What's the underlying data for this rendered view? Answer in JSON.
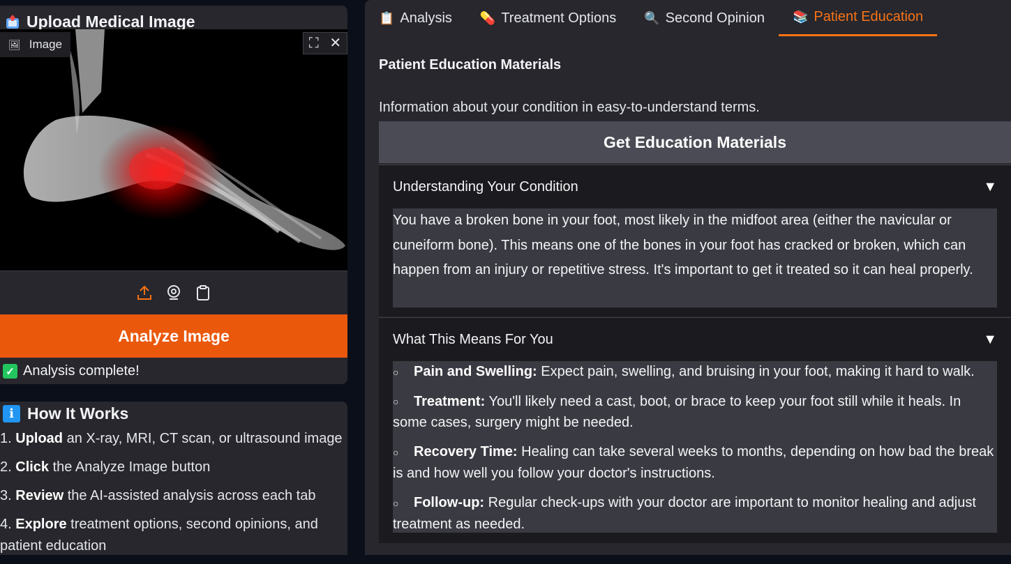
{
  "upload": {
    "title": "Upload Medical Image",
    "image_label": "Image",
    "analyze_button": "Analyze Image",
    "status": "Analysis complete!"
  },
  "how": {
    "title": "How It Works",
    "steps": [
      {
        "num": "1.",
        "bold": "Upload",
        "rest": " an X-ray, MRI, CT scan, or ultrasound image"
      },
      {
        "num": "2.",
        "bold": "Click",
        "rest": " the Analyze Image button"
      },
      {
        "num": "3.",
        "bold": "Review",
        "rest": " the AI-assisted analysis across each tab"
      },
      {
        "num": "4.",
        "bold": "Explore",
        "rest": " treatment options, second opinions, and patient education"
      }
    ]
  },
  "tabs": [
    {
      "label": "Analysis",
      "icon": "clipboard-icon"
    },
    {
      "label": "Treatment Options",
      "icon": "pill-icon"
    },
    {
      "label": "Second Opinion",
      "icon": "magnifier-icon"
    },
    {
      "label": "Patient Education",
      "icon": "books-icon"
    }
  ],
  "education": {
    "title": "Patient Education Materials",
    "description": "Information about your condition in easy-to-understand terms.",
    "button": "Get Education Materials",
    "understanding": {
      "heading": "Understanding Your Condition",
      "text": "You have a broken bone in your foot, most likely in the midfoot area (either the navicular or cuneiform bone). This means one of the bones in your foot has cracked or broken, which can happen from an injury or repetitive stress. It's important to get it treated so it can heal properly."
    },
    "meaning": {
      "heading": "What This Means For You",
      "items": [
        {
          "bold": "Pain and Swelling:",
          "text": " Expect pain, swelling, and bruising in your foot, making it hard to walk."
        },
        {
          "bold": "Treatment:",
          "text": " You'll likely need a cast, boot, or brace to keep your foot still while it heals. In some cases, surgery might be needed."
        },
        {
          "bold": "Recovery Time:",
          "text": " Healing can take several weeks to months, depending on how bad the break is and how well you follow your doctor's instructions."
        },
        {
          "bold": "Follow-up:",
          "text": " Regular check-ups with your doctor are important to monitor healing and adjust treatment as needed."
        }
      ]
    }
  },
  "colors": {
    "accent": "#ea580c",
    "active_tab": "#f97316",
    "success": "#22c55e",
    "info": "#2196f3"
  }
}
